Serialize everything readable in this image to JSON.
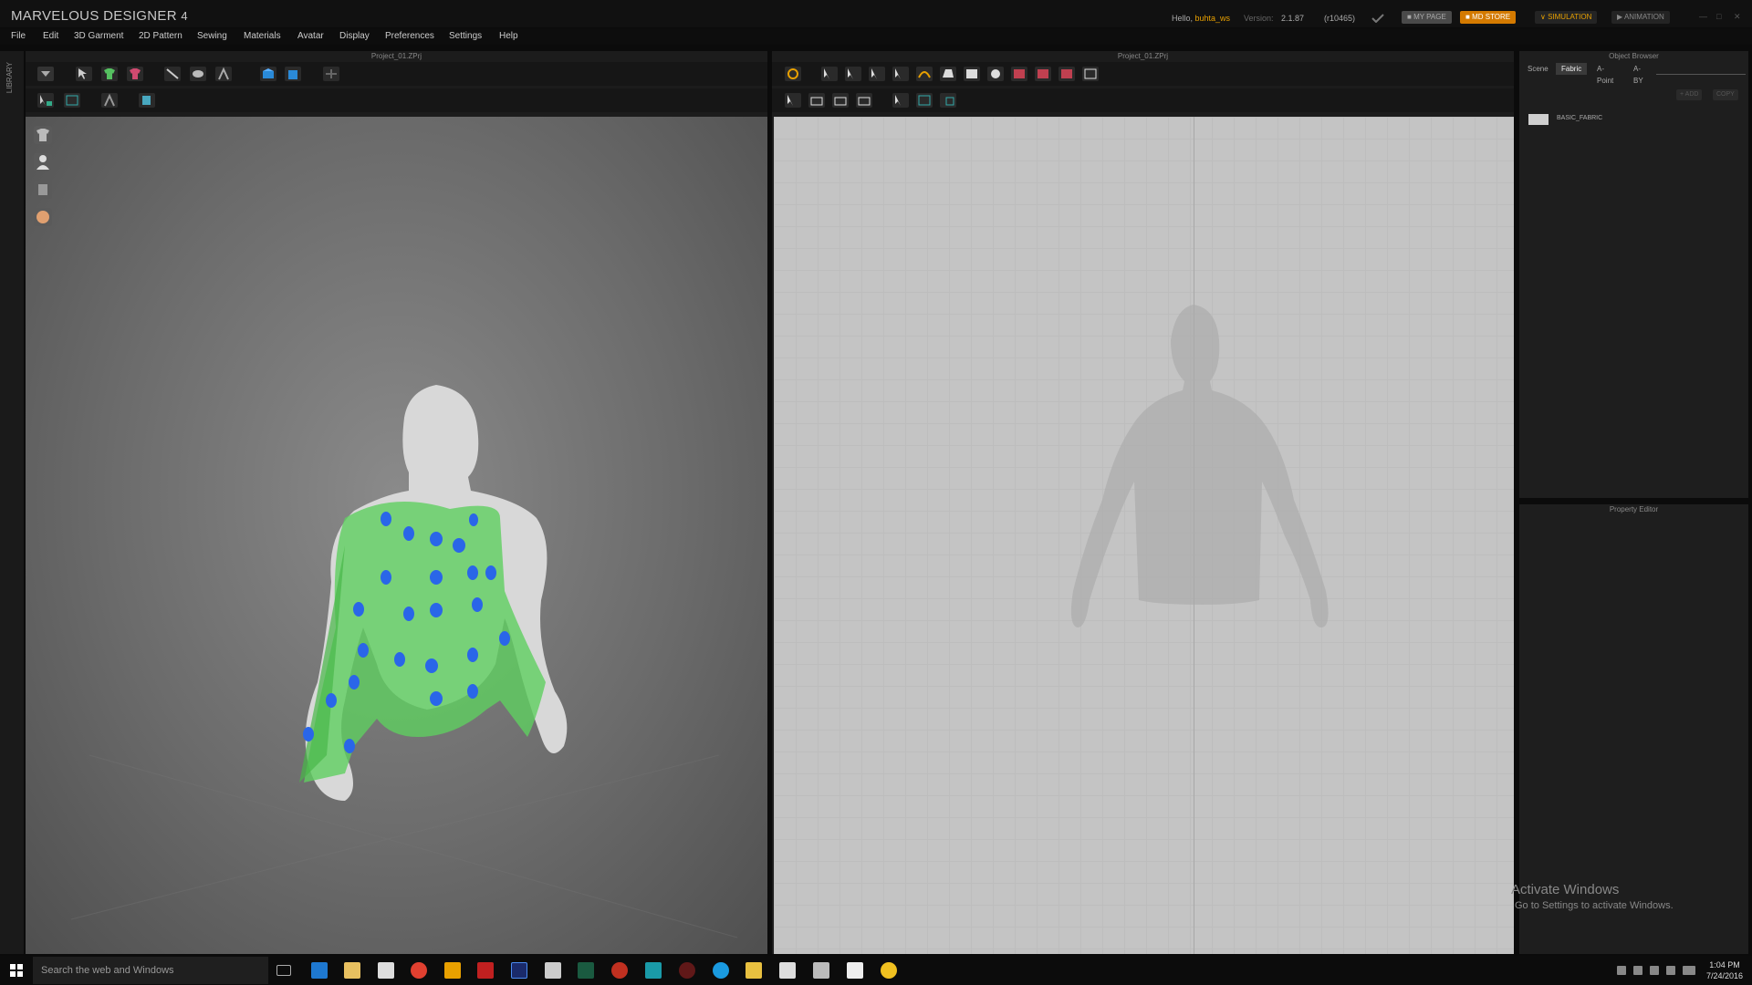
{
  "app": {
    "title": "MARVELOUS DESIGNER",
    "title_version": "4",
    "hello_prefix": "Hello, ",
    "username": "buhta_ws",
    "version_label": "Version:",
    "version_num": "2.1.87",
    "build": "(r10465)",
    "my_page": "MY PAGE",
    "md_store": "MD STORE",
    "mode_simulation": "SIMULATION",
    "mode_animation": "ANIMATION",
    "accent_color": "#e8a000",
    "store_color": "#d47a00"
  },
  "menu": [
    "File",
    "Edit",
    "3D Garment",
    "2D Pattern",
    "Sewing",
    "Materials",
    "Avatar",
    "Display",
    "Preferences",
    "Settings",
    "Help"
  ],
  "left_strip": {
    "library_label": "LIBRARY"
  },
  "panel3d": {
    "title": "Project_01.ZPrj"
  },
  "panel2d": {
    "title": "Project_01.ZPrj"
  },
  "object_browser": {
    "title": "Object Browser",
    "tabs": [
      "Scene",
      "Fabric",
      "A-Point",
      "A-BY"
    ],
    "active_tab": "Fabric",
    "add_label": "+ ADD",
    "copy_label": "COPY",
    "fabric_name": "BASIC_FABRIC"
  },
  "property_editor": {
    "title": "Property Editor"
  },
  "watermark": {
    "line1": "Activate Windows",
    "line2": "Go to Settings to activate Windows."
  },
  "taskbar": {
    "search_placeholder": "Search the web and Windows",
    "time": "1:04 PM",
    "date": "7/24/2016"
  }
}
